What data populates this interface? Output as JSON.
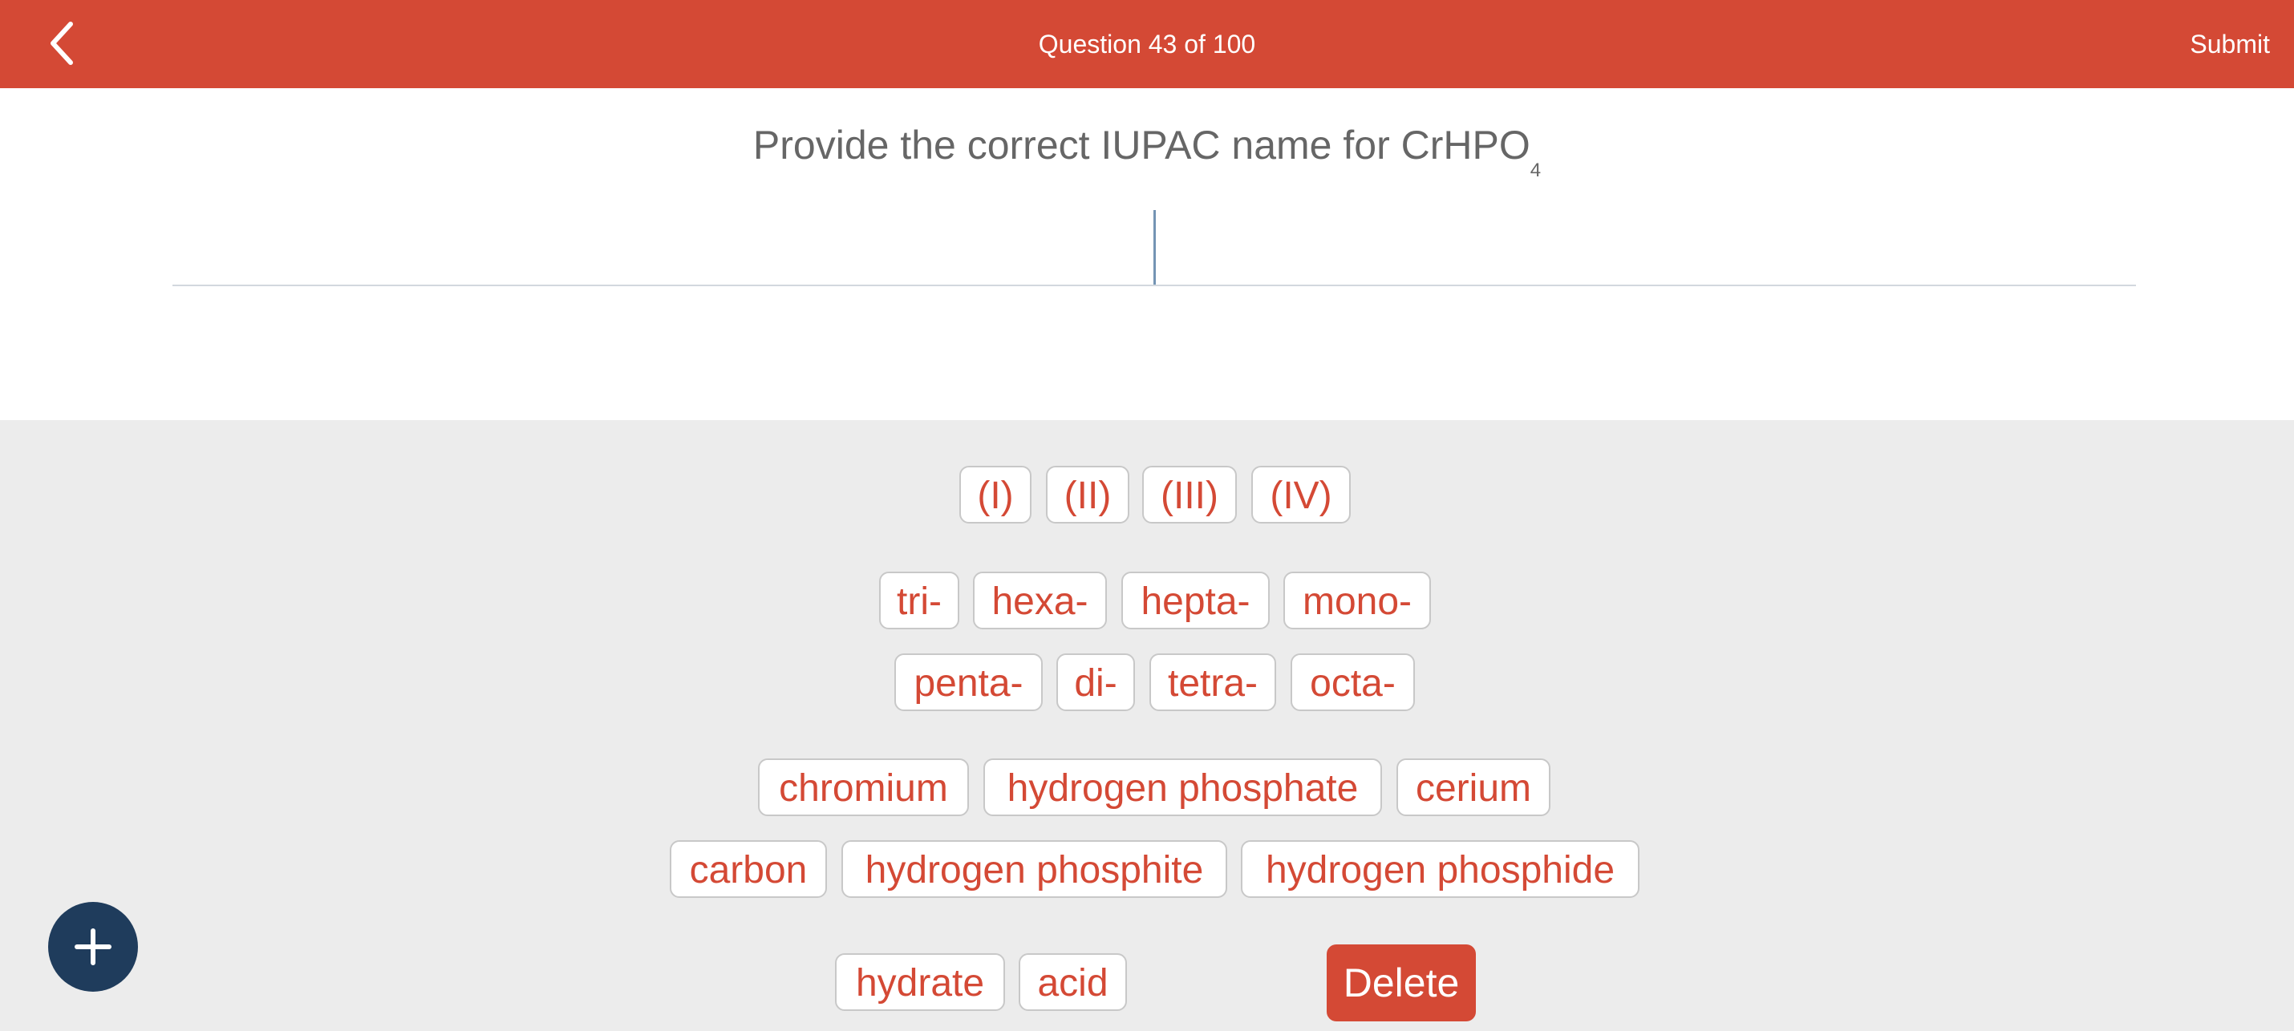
{
  "header": {
    "title": "Question 43 of 100",
    "submit_label": "Submit",
    "back_icon": "chevron-left-icon"
  },
  "question": {
    "prompt": "Provide the correct IUPAC name for CrHPO",
    "subscript": "4",
    "answer": ""
  },
  "tokens": {
    "roman": [
      "(I)",
      "(II)",
      "(III)",
      "(IV)"
    ],
    "prefixes_row1": [
      "tri-",
      "hexa-",
      "hepta-",
      "mono-"
    ],
    "prefixes_row2": [
      "penta-",
      "di-",
      "tetra-",
      "octa-"
    ],
    "names_row1": [
      "chromium",
      "hydrogen phosphate",
      "cerium"
    ],
    "names_row2": [
      "carbon",
      "hydrogen phosphite",
      "hydrogen phosphide"
    ],
    "suffixes": [
      "hydrate",
      "acid"
    ]
  },
  "actions": {
    "delete_label": "Delete",
    "add_icon": "plus-icon"
  },
  "colors": {
    "accent": "#d44935",
    "fab": "#1f3c5c",
    "tray_background": "#ececec"
  }
}
